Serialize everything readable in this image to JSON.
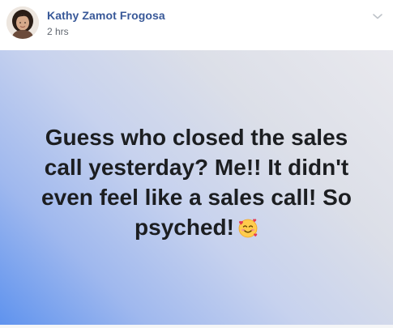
{
  "post": {
    "author": "Kathy Zamot Frogosa",
    "time": "2 hrs",
    "text": "Guess who closed the sales call yesterday? Me!! It didn't even feel like a sales call! So psyched!",
    "emoji": "smiling-face-with-hearts",
    "background_gradient": [
      "#e9e9ee",
      "#c7d2ee",
      "#5f93ee"
    ]
  },
  "colors": {
    "author_link": "#385898",
    "meta_text": "#616770",
    "post_text": "#1c1e21"
  },
  "icons": {
    "options": "chevron-down-icon",
    "avatar": "avatar"
  }
}
